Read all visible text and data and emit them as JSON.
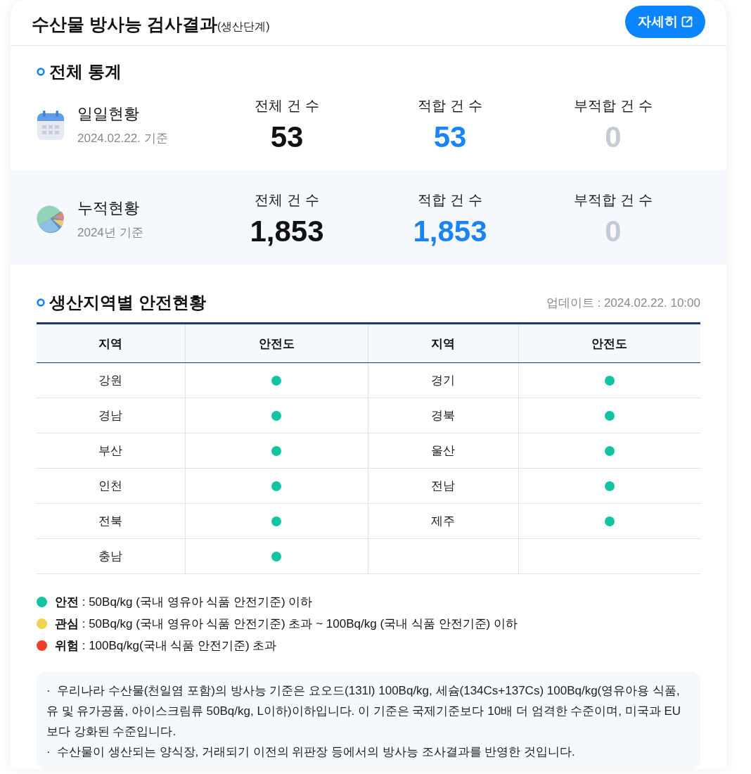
{
  "header": {
    "title": "수산물 방사능 검사결과",
    "stage": "(생산단계)",
    "detail_button": "자세히"
  },
  "overall": {
    "title": "전체 통계",
    "rows": [
      {
        "kind": "daily",
        "label": "일일현황",
        "basis": "2024.02.22. 기준",
        "metrics": [
          {
            "kind": "total",
            "label": "전체 건 수",
            "value": "53"
          },
          {
            "kind": "pass",
            "label": "적합 건 수",
            "value": "53"
          },
          {
            "kind": "fail",
            "label": "부적합 건 수",
            "value": "0"
          }
        ]
      },
      {
        "kind": "cumulative",
        "label": "누적현황",
        "basis": "2024년 기준",
        "metrics": [
          {
            "kind": "total",
            "label": "전체 건 수",
            "value": "1,853"
          },
          {
            "kind": "pass",
            "label": "적합 건 수",
            "value": "1,853"
          },
          {
            "kind": "fail",
            "label": "부적합 건 수",
            "value": "0"
          }
        ]
      }
    ]
  },
  "regional": {
    "title": "생산지역별 안전현황",
    "updated": "업데이트 : 2024.02.22. 10:00",
    "columns": [
      "지역",
      "안전도",
      "지역",
      "안전도"
    ],
    "rows": [
      {
        "region": "강원",
        "color": "#13c4a3"
      },
      {
        "region": "경기",
        "color": "#13c4a3"
      },
      {
        "region": "경남",
        "color": "#13c4a3"
      },
      {
        "region": "경북",
        "color": "#13c4a3"
      },
      {
        "region": "부산",
        "color": "#13c4a3"
      },
      {
        "region": "울산",
        "color": "#13c4a3"
      },
      {
        "region": "인천",
        "color": "#13c4a3"
      },
      {
        "region": "전남",
        "color": "#13c4a3"
      },
      {
        "region": "전북",
        "color": "#13c4a3"
      },
      {
        "region": "제주",
        "color": "#13c4a3"
      },
      {
        "region": "충남",
        "color": "#13c4a3"
      }
    ]
  },
  "legend": [
    {
      "text": "**안전** : 50Bq/kg (국내 영유아 식품 안전기준) 이하",
      "color": "#13c4a3"
    },
    {
      "text": "**관심** : 50Bq/kg (국내 영유아 식품 안전기준) 초과 ~ 100Bq/kg (국내 식품 안전기준) 이하",
      "color": "#f2d250"
    },
    {
      "text": "**위험** : 100Bq/kg(국내 식품 안전기준) 초과",
      "color": "#f23c2b"
    }
  ],
  "notice": [
    "·  우리나라 수산물(천일염 포함)의 방사능 기준은 요오드(131l) 100Bq/kg, 세슘(134Cs+137Cs) 100Bq/kg(영유아용 식품, 유 및 유가공품, 아이스크림류 50Bq/kg, L이하)이하입니다. 이 기준은 국제기준보다 10배 더 엄격한 수준이며, 미국과 EU보다 강화된 수준입니다.",
    "·  수산물이 생산되는 양식장, 거래되기 이전의 위판장 등에서의 방사능 조사결과를 반영한 것입니다."
  ]
}
